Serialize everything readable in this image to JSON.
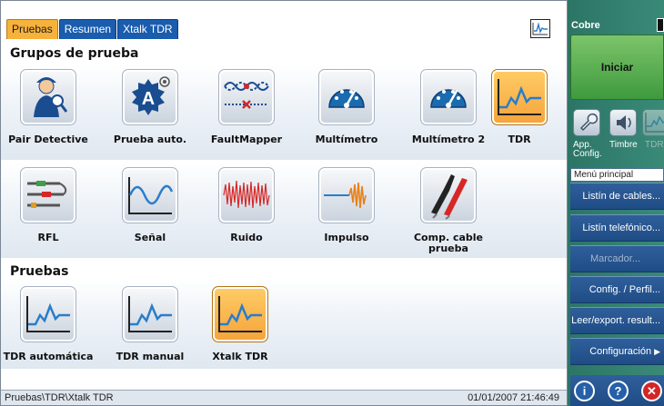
{
  "tabs": [
    {
      "label": "Pruebas",
      "active": true
    },
    {
      "label": "Resumen",
      "active": false
    },
    {
      "label": "Xtalk TDR",
      "active": false
    }
  ],
  "sections": {
    "grupos": "Grupos de prueba",
    "pruebas": "Pruebas"
  },
  "grupos_tiles": [
    {
      "label": "Pair Detective",
      "icon": "pair-detective-icon"
    },
    {
      "label": "Prueba auto.",
      "icon": "auto-test-icon"
    },
    {
      "label": "FaultMapper",
      "icon": "faultmapper-icon"
    },
    {
      "label": "Multímetro",
      "icon": "multimeter-icon"
    },
    {
      "label": "Multímetro 2",
      "icon": "multimeter-2-icon"
    },
    {
      "label": "TDR",
      "icon": "tdr-icon",
      "selected": true
    },
    {
      "label": "RFL",
      "icon": "rfl-icon"
    },
    {
      "label": "Señal",
      "icon": "signal-icon"
    },
    {
      "label": "Ruido",
      "icon": "noise-icon"
    },
    {
      "label": "Impulso",
      "icon": "impulse-icon"
    },
    {
      "label": "Comp. cable prueba",
      "icon": "test-cable-comp-icon"
    }
  ],
  "pruebas_tiles": [
    {
      "label": "TDR automática",
      "icon": "tdr-auto-icon"
    },
    {
      "label": "TDR manual",
      "icon": "tdr-manual-icon"
    },
    {
      "label": "Xtalk TDR",
      "icon": "xtalk-tdr-icon",
      "selected": true
    }
  ],
  "status": {
    "path": "Pruebas\\TDR\\Xtalk TDR",
    "datetime": "01/01/2007 21:46:49"
  },
  "side": {
    "title": "Cobre",
    "start_button": "Iniciar",
    "quick": [
      {
        "label": "App. Config.",
        "icon": "wrench-icon"
      },
      {
        "label": "Timbre",
        "icon": "speaker-icon"
      },
      {
        "label": "TDR",
        "icon": "tdr-mini-icon"
      }
    ],
    "menu_header": "Menú principal",
    "menu": [
      {
        "label": "Listín de cables...",
        "enabled": true
      },
      {
        "label": "Listín telefónico...",
        "enabled": true
      },
      {
        "label": "Marcador...",
        "enabled": false
      },
      {
        "label": "Config. / Perfil...",
        "enabled": true
      },
      {
        "label": "Leer/export. result...",
        "enabled": true
      },
      {
        "label": "Configuración",
        "enabled": true,
        "submenu": true
      }
    ],
    "bottom_buttons": [
      {
        "symbol": "i",
        "icon": "info-icon"
      },
      {
        "symbol": "?",
        "icon": "help-icon"
      },
      {
        "symbol": "✕",
        "icon": "close-icon"
      }
    ]
  },
  "colors": {
    "tab_active": "#f7b23b",
    "tab_inactive": "#1a5cad",
    "side_panel": "#2c7566",
    "start_button": "#5aab4f",
    "menu_item": "#2a5891",
    "selected_tile": "#f8b84b"
  }
}
